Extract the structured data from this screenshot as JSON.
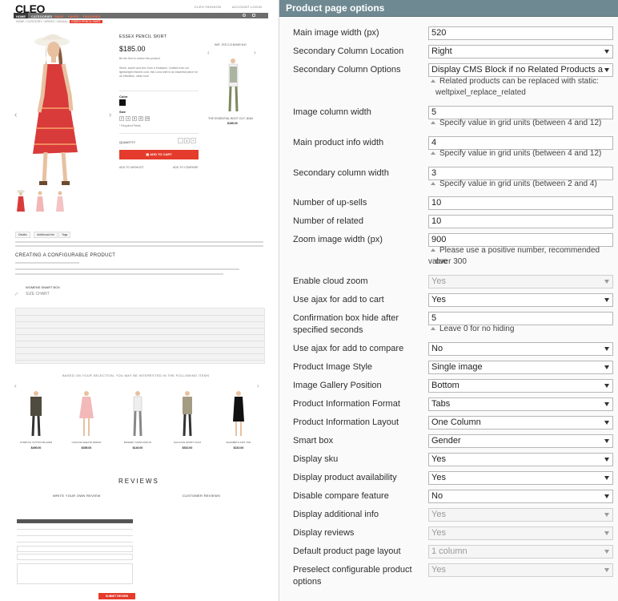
{
  "storefront": {
    "logo": "CLEO",
    "top_links": [
      "CLEO FASHION",
      "ACCOUNT",
      "LOGIN"
    ],
    "nav": [
      "HOME",
      "CATEGORIES",
      "SHOP",
      "PAGES",
      "FEATURES"
    ],
    "breadcrumb": "HOME  /  CATEGORY  /  DRESS  /  CASUAL  /",
    "breadcrumb_current": "ESSEX PENCIL SKIRT",
    "product_name": "ESSEX PENCIL SKIRT",
    "price": "$185.00",
    "short_note": "Be the first to review this product",
    "description": "Sleek, sweet and chic from a Knitwave, Crafted from our lightweight relaxed cord, this Luna shirt is an essential piece for an effortless, clean look.",
    "color_label": "Color",
    "size_label": "Size",
    "sizes": [
      "2",
      "4",
      "6",
      "8",
      "10"
    ],
    "required": "* Required Fields",
    "qty_label": "QUANTITY",
    "qty_value": "1",
    "add_to_cart": "ADD TO CART",
    "wishlist": "ADD TO WISHLIST",
    "compare": "ADD TO COMPARE",
    "we_recommend": "WE RECOMMEND",
    "rec_name": "THE ESSENTIAL BOOT CUT JEAN",
    "rec_price": "$185.00",
    "tabs": [
      "Details",
      "Additional Info",
      "Tags"
    ],
    "section_title": "CREATING A CONFIGURABLE PRODUCT",
    "smartbox_title": "WOMENS SMART BOX",
    "size_chart": "SIZE CHART",
    "interested": "BASED ON YOUR SELECTION, YOU MAY BE INTERESTED IN THE FOLLOWING ITEMS",
    "products": [
      {
        "name": "STRETCH COTTON BLAZER",
        "price": "$490.00"
      },
      {
        "name": "LUDLOW SHEATH DRESS",
        "price": "$355.00"
      },
      {
        "name": "BOWERY CHINO PANTS",
        "price": "$140.00"
      },
      {
        "name": "SULLIVAN SPORT COAT",
        "price": "$510.00"
      },
      {
        "name": "ELIZABETH KNIT TOP",
        "price": "$210.00"
      }
    ],
    "reviews_title": "REVIEWS",
    "write_review": "WRITE YOUR OWN REVIEW",
    "customer_reviews": "CUSTOMER REVIEWS",
    "submit_review": "SUBMIT REVIEW"
  },
  "panel": {
    "title": "Product page options",
    "fields": [
      {
        "label": "Main image width (px)",
        "type": "input",
        "value": "520"
      },
      {
        "label": "Secondary Column Location",
        "type": "select",
        "value": "Right"
      },
      {
        "label": "Secondary Column Options",
        "type": "select",
        "value": "Display CMS Block if no Related Products available",
        "note": "Related products can be replaced with static:",
        "note2": "weltpixel_replace_related"
      },
      {
        "label": "Image column width",
        "type": "input",
        "value": "5",
        "note": "Specify value in grid units (between 4 and 12)"
      },
      {
        "label": "Main product info width",
        "type": "input",
        "value": "4",
        "note": "Specify value in grid units (between 4 and 12)"
      },
      {
        "label": "Secondary column width",
        "type": "input",
        "value": "3",
        "note": "Specify value in grid units (between 2 and 4)"
      },
      {
        "label": "Number of up-sells",
        "type": "input",
        "value": "10"
      },
      {
        "label": "Number of related",
        "type": "input",
        "value": "10"
      },
      {
        "label": "Zoom image width (px)",
        "type": "input",
        "value": "900",
        "note": "Please use a positive number, recommended value",
        "note2": "over 300"
      },
      {
        "label": "Enable cloud zoom",
        "type": "select",
        "value": "Yes",
        "disabled": true
      },
      {
        "label": "Use ajax for add to cart",
        "type": "select",
        "value": "Yes"
      },
      {
        "label": "Confirmation box hide after",
        "label2": "specified seconds",
        "type": "input",
        "value": "5",
        "note": "Leave 0 for no hiding"
      },
      {
        "label": "Use ajax for add to compare",
        "type": "select",
        "value": "No"
      },
      {
        "label": "Product Image Style",
        "type": "select",
        "value": "Single image"
      },
      {
        "label": "Image Gallery Position",
        "type": "select",
        "value": "Bottom"
      },
      {
        "label": "Product Information Format",
        "type": "select",
        "value": "Tabs"
      },
      {
        "label": "Product Information Layout",
        "type": "select",
        "value": "One Column"
      },
      {
        "label": "Smart box",
        "type": "select",
        "value": "Gender"
      },
      {
        "label": "Display sku",
        "type": "select",
        "value": "Yes"
      },
      {
        "label": "Display product availability",
        "type": "select",
        "value": "Yes"
      },
      {
        "label": "Disable compare feature",
        "type": "select",
        "value": "No"
      },
      {
        "label": "Display additional info",
        "type": "select",
        "value": "Yes",
        "disabled": true
      },
      {
        "label": "Display reviews",
        "type": "select",
        "value": "Yes",
        "disabled": true
      },
      {
        "label": "Default product page layout",
        "type": "select",
        "value": "1 column",
        "disabled": true
      },
      {
        "label": "Preselect configurable product",
        "label2": "options",
        "type": "select",
        "value": "Yes",
        "disabled": true
      }
    ]
  },
  "colors": {
    "panel_header": "#6f8992",
    "accent_red": "#e53b2c",
    "dress_red": "#d93a3a"
  }
}
